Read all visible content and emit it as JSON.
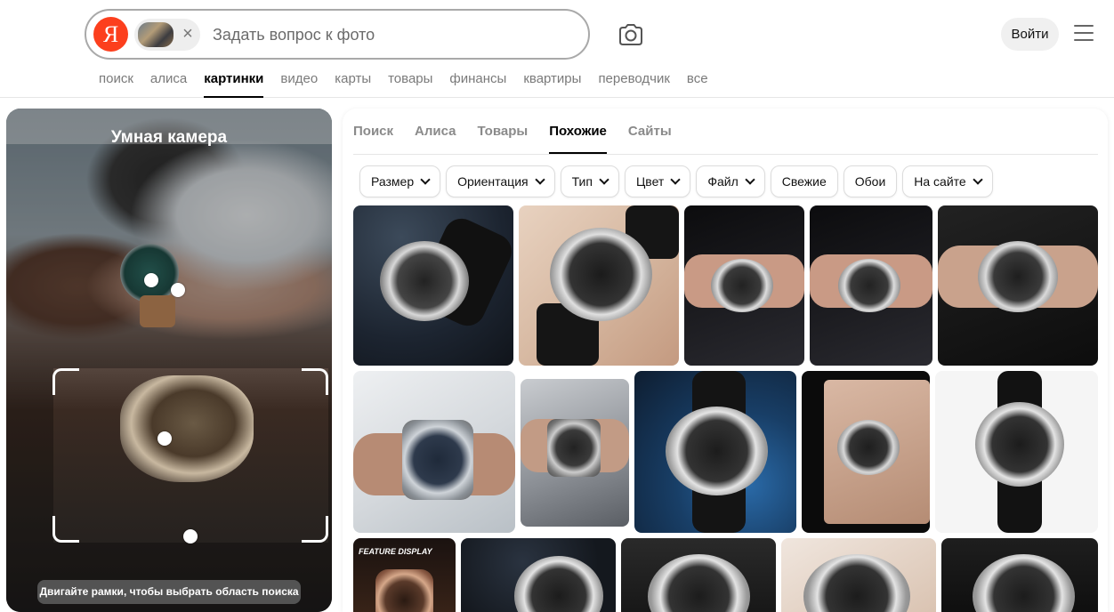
{
  "header": {
    "logo_letter": "Я",
    "query_placeholder": "Задать вопрос к фото",
    "remove_symbol": "×",
    "login_label": "Войти"
  },
  "nav": {
    "items": [
      {
        "label": "поиск",
        "active": false
      },
      {
        "label": "алиса",
        "active": false
      },
      {
        "label": "картинки",
        "active": true
      },
      {
        "label": "видео",
        "active": false
      },
      {
        "label": "карты",
        "active": false
      },
      {
        "label": "товары",
        "active": false
      },
      {
        "label": "финансы",
        "active": false
      },
      {
        "label": "квартиры",
        "active": false
      },
      {
        "label": "переводчик",
        "active": false
      },
      {
        "label": "все",
        "active": false
      }
    ]
  },
  "smart_camera": {
    "title": "Умная камера",
    "hint": "Двигайте рамки, чтобы выбрать область поиска"
  },
  "results": {
    "tabs": [
      {
        "label": "Поиск",
        "active": false
      },
      {
        "label": "Алиса",
        "active": false
      },
      {
        "label": "Товары",
        "active": false
      },
      {
        "label": "Похожие",
        "active": true
      },
      {
        "label": "Сайты",
        "active": false
      }
    ],
    "filters": [
      {
        "label": "Размер",
        "dropdown": true
      },
      {
        "label": "Ориентация",
        "dropdown": true
      },
      {
        "label": "Тип",
        "dropdown": true
      },
      {
        "label": "Цвет",
        "dropdown": true
      },
      {
        "label": "Файл",
        "dropdown": true
      },
      {
        "label": "Свежие",
        "dropdown": false
      },
      {
        "label": "Обои",
        "dropdown": false
      },
      {
        "label": "На сайте",
        "dropdown": true
      }
    ],
    "image_overlay_text": "FEATURE DISPLAY"
  },
  "colors": {
    "brand_red": "#fc3f1d",
    "active_text": "#000000",
    "muted_text": "#7a7a7a"
  }
}
